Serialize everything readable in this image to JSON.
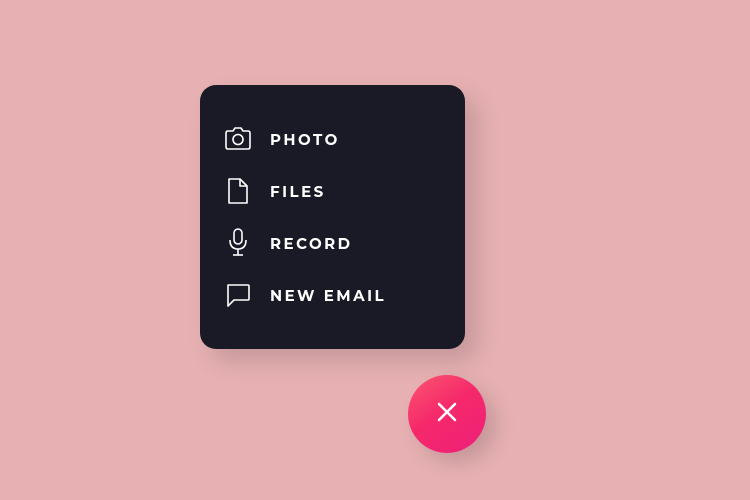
{
  "menu": {
    "items": [
      {
        "label": "PHOTO",
        "icon": "camera"
      },
      {
        "label": "FILES",
        "icon": "file"
      },
      {
        "label": "RECORD",
        "icon": "microphone"
      },
      {
        "label": "NEW EMAIL",
        "icon": "chat"
      }
    ]
  },
  "fab": {
    "icon": "close"
  },
  "colors": {
    "background": "#e7b1b3",
    "panel": "#191a26",
    "text": "#ffffff",
    "fabGradientStart": "#fc5871",
    "fabGradientEnd": "#ee1f7a"
  }
}
